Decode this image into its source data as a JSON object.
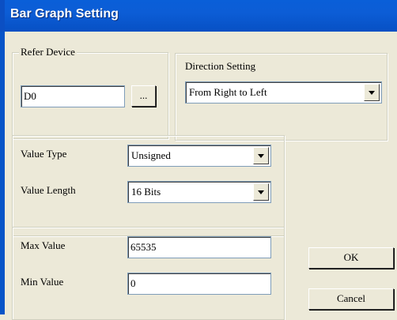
{
  "window": {
    "title": "Bar Graph Setting"
  },
  "refer_device": {
    "legend": "Refer Device",
    "value": "D0",
    "browse_label": "..."
  },
  "direction": {
    "label": "Direction Setting",
    "selected": "From Right to Left"
  },
  "value_type": {
    "label": "Value Type",
    "selected": "Unsigned"
  },
  "value_length": {
    "label": "Value Length",
    "selected": "16 Bits"
  },
  "max_value": {
    "label": "Max Value",
    "value": "65535"
  },
  "min_value": {
    "label": "Min Value",
    "value": "0"
  },
  "buttons": {
    "ok": "OK",
    "cancel": "Cancel"
  },
  "icons": {
    "dropdown": "chevron-down-icon"
  }
}
